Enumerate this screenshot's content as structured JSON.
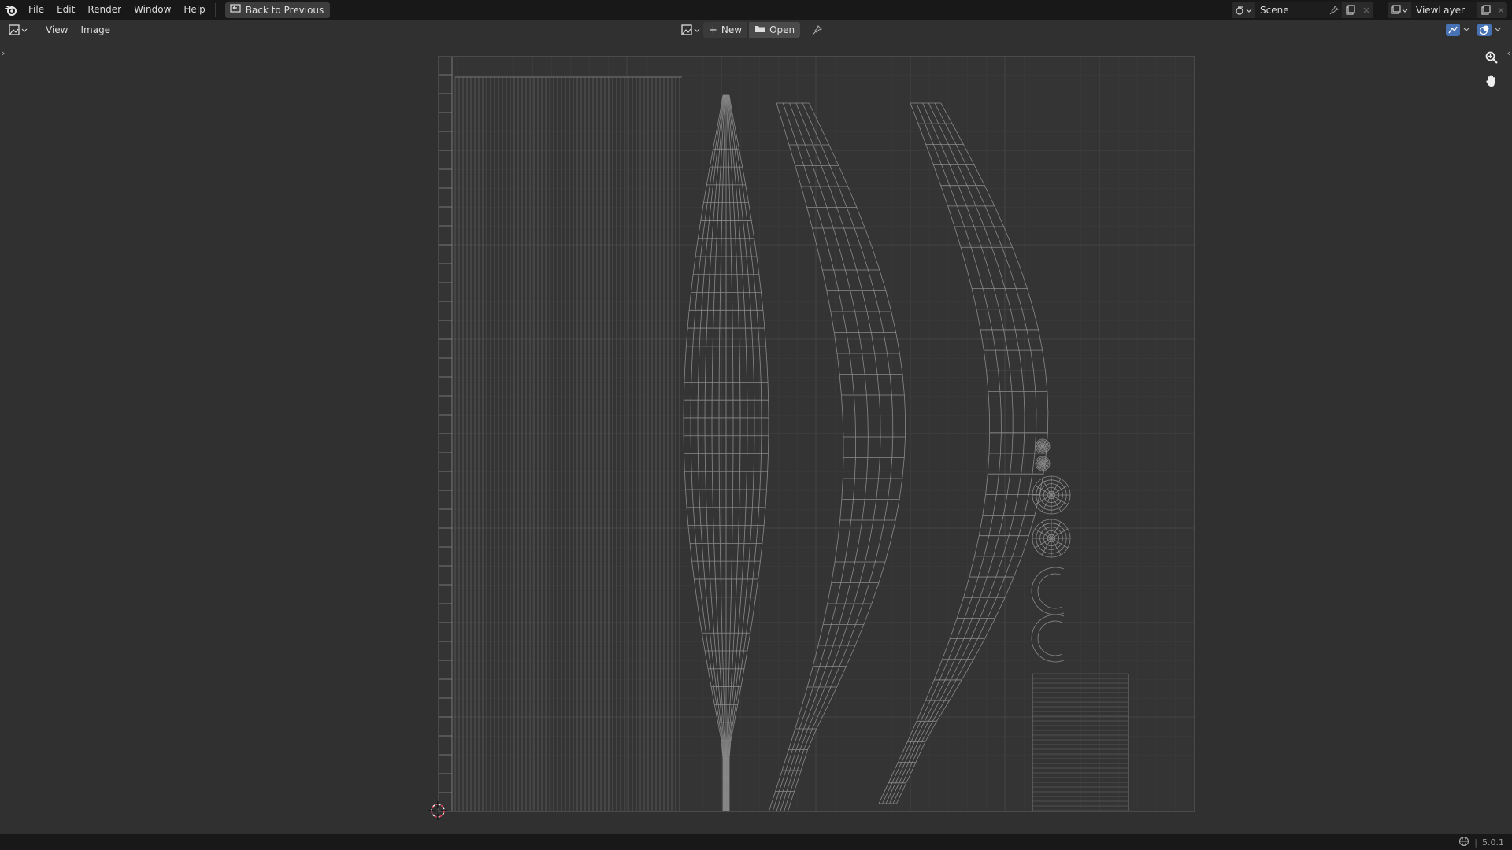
{
  "topbar": {
    "menus": [
      "File",
      "Edit",
      "Render",
      "Window",
      "Help"
    ],
    "back_label": "Back to Previous",
    "scene_name": "Scene",
    "view_layer": "ViewLayer"
  },
  "header": {
    "menus": [
      "View",
      "Image"
    ],
    "new_label": "New",
    "open_label": "Open"
  },
  "statusbar": {
    "version": "5.0.1"
  },
  "colors": {
    "background": "#303030",
    "topbar": "#181818",
    "uv_wire": "#8a8a8a",
    "cursor_red": "#e0405a"
  },
  "icons": [
    "blender-logo-icon",
    "back-screen-icon",
    "scene-icon",
    "pin-icon",
    "new-scene-icon",
    "close-icon",
    "viewlayer-icon",
    "image-editor-icon",
    "image-browse-icon",
    "plus-icon",
    "folder-icon",
    "uv-sync-icon",
    "overlay-icon",
    "zoom-icon",
    "hand-icon",
    "network-icon",
    "2d-cursor-icon"
  ]
}
